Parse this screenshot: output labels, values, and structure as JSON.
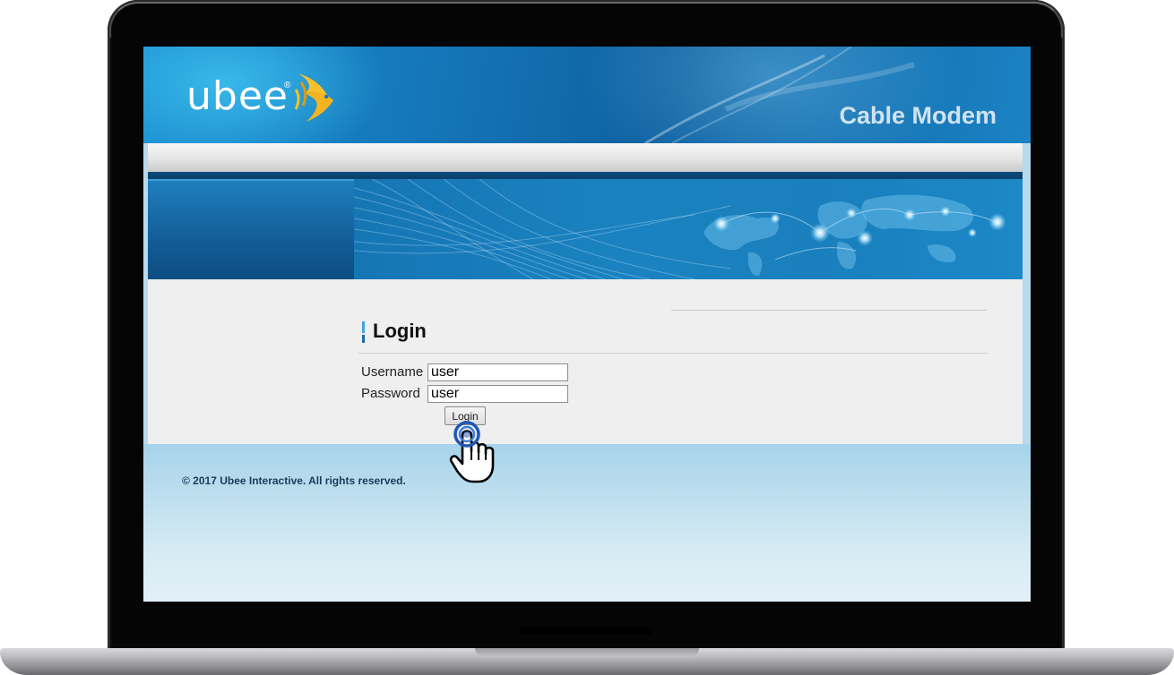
{
  "header": {
    "logo_text": "ubee",
    "logo_registered": "®",
    "brand_subtitle": "Cable Modem"
  },
  "login": {
    "heading": "Login",
    "username_label": "Username",
    "username_value": "user",
    "password_label": "Password",
    "password_value": "user",
    "submit_label": "Login"
  },
  "footer": {
    "copyright": "© 2017 Ubee Interactive. All rights reserved."
  },
  "icons": {
    "logo": "fish-logo-icon",
    "cursor": "hand-pointer-icon",
    "map": "world-map-icon"
  },
  "colors": {
    "header_blue": "#1474b6",
    "logo_gold": "#f5b41f",
    "content_bg": "#efefef",
    "footer_blue": "#a6d3ea",
    "click_ring": "#1e56b8"
  }
}
